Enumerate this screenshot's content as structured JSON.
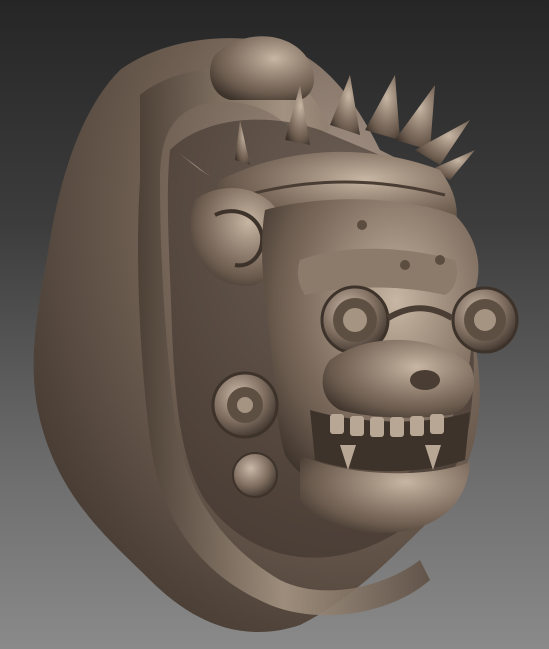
{
  "scene": {
    "subject": "sculpted-monkey-head-bust",
    "colors": {
      "background_top": "#262626",
      "background_bottom": "#8a8a8a",
      "clay_base": "#7a6a5c",
      "clay_highlight": "#c7b6a3",
      "clay_shadow": "#3d332b"
    }
  }
}
